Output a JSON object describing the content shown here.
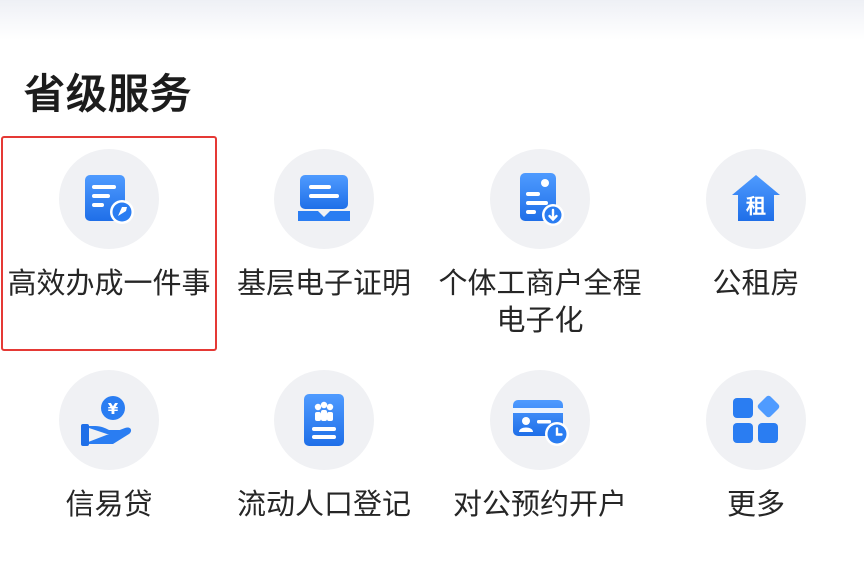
{
  "section": {
    "title": "省级服务"
  },
  "services": [
    {
      "label": "高效办成一件事",
      "icon": "document-rocket-icon",
      "selected": true
    },
    {
      "label": "基层电子证明",
      "icon": "certificate-icon",
      "selected": false
    },
    {
      "label": "个体工商户全程电子化",
      "icon": "document-download-icon",
      "selected": false
    },
    {
      "label": "公租房",
      "icon": "rent-house-icon",
      "icon_text": "租",
      "selected": false
    },
    {
      "label": "信易贷",
      "icon": "hand-coin-icon",
      "icon_text": "¥",
      "selected": false
    },
    {
      "label": "流动人口登记",
      "icon": "people-register-icon",
      "selected": false
    },
    {
      "label": "对公预约开户",
      "icon": "card-clock-icon",
      "selected": false
    },
    {
      "label": "更多",
      "icon": "grid-apps-icon",
      "selected": false
    }
  ],
  "colors": {
    "accent": "#2a7df2",
    "selected_border": "#e53935",
    "icon_bg": "#f0f1f4"
  }
}
